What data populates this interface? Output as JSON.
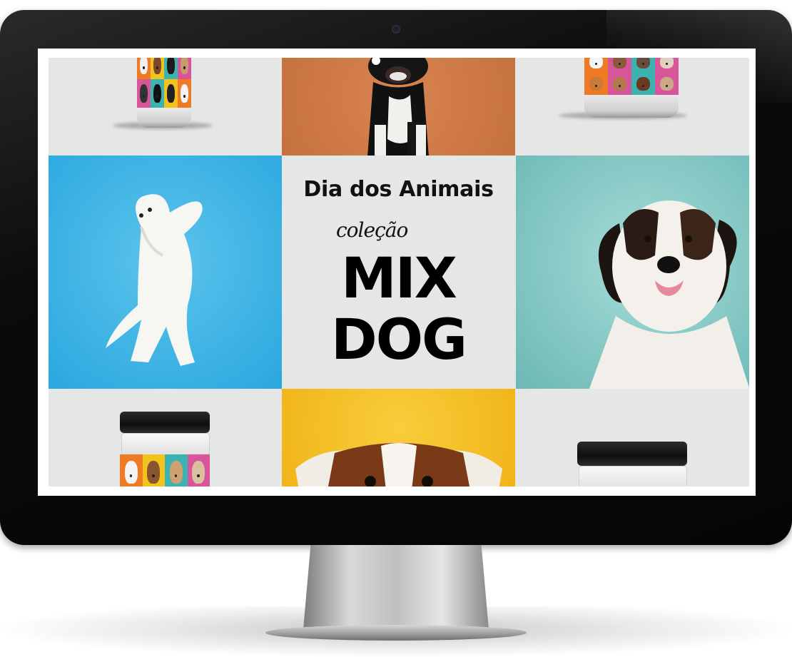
{
  "banner": {
    "headline": "Dia dos Animais",
    "collection_label": "coleção",
    "title_line1": "MIX",
    "title_line2": "DOG"
  },
  "colors": {
    "bezel": "#050505",
    "grey_tile": "#e5e6e6",
    "orange_tile": "#c5703f",
    "blue_tile": "#2aa7df",
    "teal_tile": "#6bb8b4",
    "yellow_tile": "#f0b419",
    "label_pink": "#d9559a",
    "label_orange": "#ee7a24",
    "label_yellow": "#f3c21d",
    "label_teal": "#3bb3b0"
  },
  "tiles": [
    "jar-top-left",
    "orange-dog-photo",
    "jar-top-right",
    "blue-westie-photo",
    "mix-dog-banner",
    "teal-saint-bernard-photo",
    "jar-bottom-left",
    "yellow-dog-photo",
    "jar-bottom-right"
  ]
}
